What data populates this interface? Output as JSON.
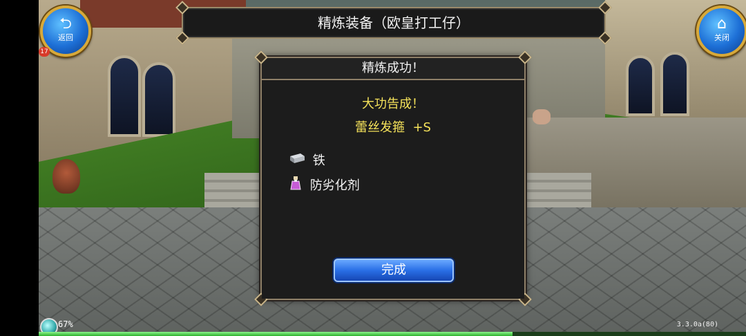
{
  "header": {
    "title": "精炼装备（欧皇打工仔）",
    "back_button": {
      "label": "返回",
      "icon": "back-arrow-icon"
    },
    "close_button": {
      "label": "关闭",
      "icon": "home-icon"
    },
    "level_badge": "17"
  },
  "dialog": {
    "title": "精炼成功！",
    "result_message": "大功告成！",
    "item_result": "蕾丝发箍  +S",
    "materials": [
      {
        "name": "铁",
        "icon": "iron-ingot-icon"
      },
      {
        "name": "防劣化剂",
        "icon": "potion-bottle-icon"
      }
    ],
    "confirm_label": "完成"
  },
  "status": {
    "percent": "67%",
    "version": "3.3.0a(80)",
    "progress": 0.67
  },
  "colors": {
    "result_text": "#f4e15a",
    "button_blue": "#2a6fe6",
    "dialog_bg": "#1d1d1d",
    "frame_gold": "#d7a93a"
  }
}
